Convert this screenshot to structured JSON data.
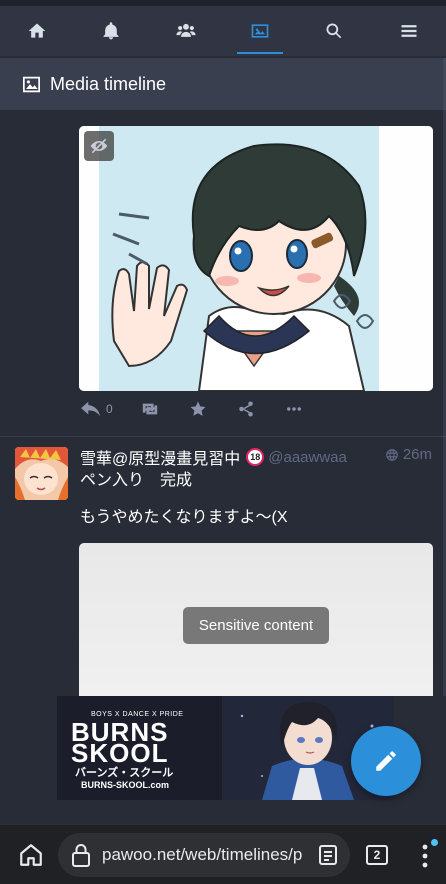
{
  "tabs": [
    {
      "name": "home",
      "icon": "home-icon"
    },
    {
      "name": "notifications",
      "icon": "bell-icon"
    },
    {
      "name": "local",
      "icon": "users-icon"
    },
    {
      "name": "media",
      "icon": "image-icon",
      "active": true
    },
    {
      "name": "search",
      "icon": "search-icon"
    },
    {
      "name": "menu",
      "icon": "hamburger-icon"
    }
  ],
  "column": {
    "title": "Media timeline",
    "icon": "image-icon"
  },
  "post1": {
    "actions": {
      "reply_count": "0"
    }
  },
  "post2": {
    "display_name": "雪華@原型漫畫見習中",
    "r18_badge": "18",
    "acct": "@aaawwaa",
    "time": "26m",
    "lines": [
      "ペン入り　完成",
      "もうやめたくなりますよ〜(X"
    ],
    "sensitive_label": "Sensitive content"
  },
  "ad": {
    "tagline": "BOYS X DANCE X PRIDE",
    "title_line1": "BURNS",
    "title_line2": "SKOOL",
    "kana": "バーンズ・スクール",
    "url": "BURNS-SKOOL.com"
  },
  "browser": {
    "url": "pawoo.net/web/timelines/p",
    "tab_count": "2"
  },
  "colors": {
    "accent": "#2b90d9",
    "bg": "#282c37",
    "header": "#393f4f",
    "tabbar": "#313543"
  }
}
